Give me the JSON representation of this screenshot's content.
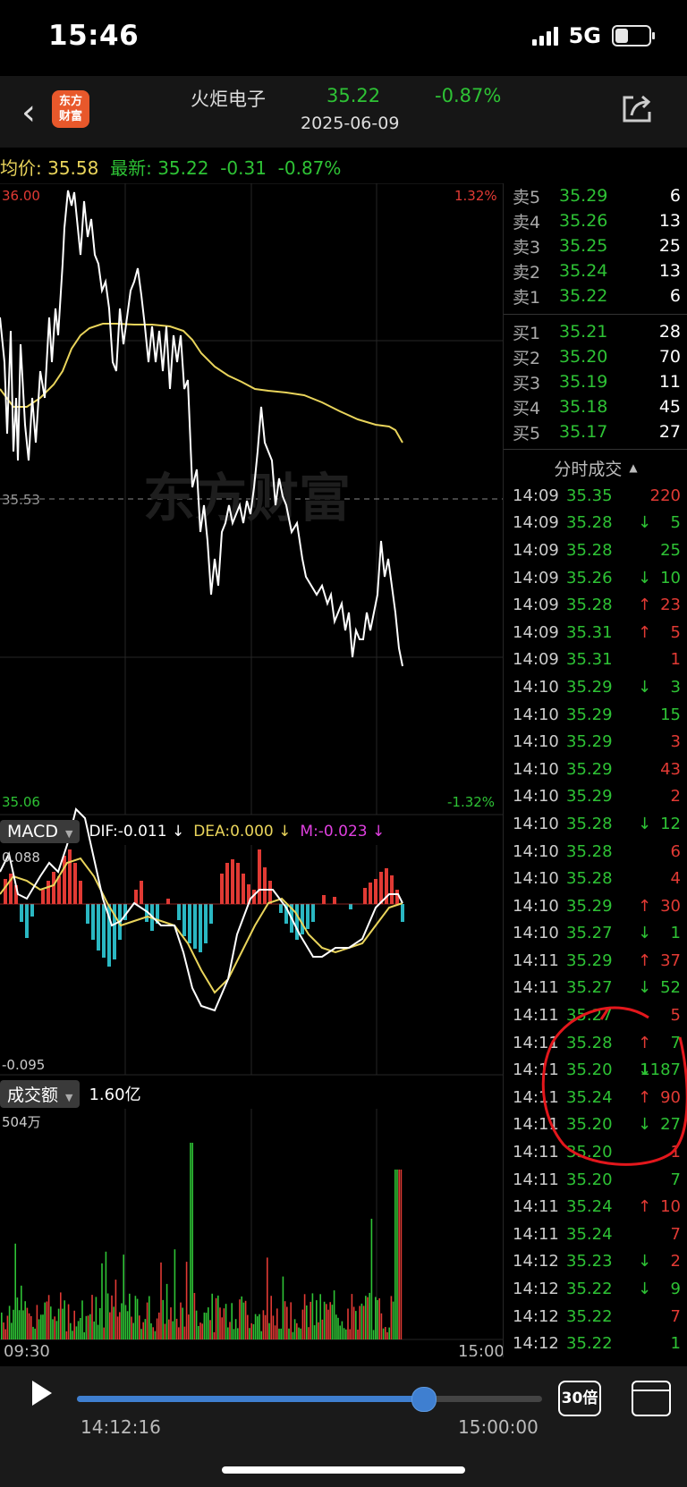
{
  "status": {
    "time": "15:46",
    "network": "5G"
  },
  "header": {
    "name": "火炬电子",
    "price": "35.22",
    "change_pct": "-0.87%",
    "date": "2025-06-09",
    "logo_text": "东方财富"
  },
  "info": {
    "avg_label": "均价:",
    "avg_value": "35.58",
    "latest_label": "最新:",
    "latest_value": "35.22",
    "change": "-0.31",
    "change_pct": "-0.87%"
  },
  "price_chart": {
    "y_high": "36.00",
    "y_mid": "35.53",
    "y_low": "35.06",
    "pct_high": "1.32%",
    "pct_low": "-1.32%",
    "watermark": "东方财富"
  },
  "macd": {
    "selector": "MACD",
    "dif": "DIF:-0.011",
    "dea": "DEA:0.000",
    "m": "M:-0.023",
    "arrow": "↓",
    "y_high": "0.088",
    "y_low": "-0.095"
  },
  "volume": {
    "selector": "成交额",
    "total": "1.60亿",
    "y_max": "504万",
    "x_start": "09:30",
    "x_end": "15:00"
  },
  "orderbook": {
    "sells": [
      {
        "label": "卖5",
        "price": "35.29",
        "vol": "6"
      },
      {
        "label": "卖4",
        "price": "35.26",
        "vol": "13"
      },
      {
        "label": "卖3",
        "price": "35.25",
        "vol": "25"
      },
      {
        "label": "卖2",
        "price": "35.24",
        "vol": "13"
      },
      {
        "label": "卖1",
        "price": "35.22",
        "vol": "6"
      }
    ],
    "buys": [
      {
        "label": "买1",
        "price": "35.21",
        "vol": "28"
      },
      {
        "label": "买2",
        "price": "35.20",
        "vol": "70"
      },
      {
        "label": "买3",
        "price": "35.19",
        "vol": "11"
      },
      {
        "label": "买4",
        "price": "35.18",
        "vol": "45"
      },
      {
        "label": "买5",
        "price": "35.17",
        "vol": "27"
      }
    ]
  },
  "ticks_header": {
    "title": "分时成交",
    "arrow": "▲"
  },
  "ticks": [
    {
      "t": "14:09",
      "p": "35.35",
      "a": "",
      "v": "220",
      "c": "red"
    },
    {
      "t": "14:09",
      "p": "35.28",
      "a": "↓",
      "v": "5",
      "c": "green"
    },
    {
      "t": "14:09",
      "p": "35.28",
      "a": "",
      "v": "25",
      "c": "green"
    },
    {
      "t": "14:09",
      "p": "35.26",
      "a": "↓",
      "v": "10",
      "c": "green"
    },
    {
      "t": "14:09",
      "p": "35.28",
      "a": "↑",
      "v": "23",
      "c": "red"
    },
    {
      "t": "14:09",
      "p": "35.31",
      "a": "↑",
      "v": "5",
      "c": "red"
    },
    {
      "t": "14:09",
      "p": "35.31",
      "a": "",
      "v": "1",
      "c": "red"
    },
    {
      "t": "14:10",
      "p": "35.29",
      "a": "↓",
      "v": "3",
      "c": "green"
    },
    {
      "t": "14:10",
      "p": "35.29",
      "a": "",
      "v": "15",
      "c": "green"
    },
    {
      "t": "14:10",
      "p": "35.29",
      "a": "",
      "v": "3",
      "c": "red"
    },
    {
      "t": "14:10",
      "p": "35.29",
      "a": "",
      "v": "43",
      "c": "red"
    },
    {
      "t": "14:10",
      "p": "35.29",
      "a": "",
      "v": "2",
      "c": "red"
    },
    {
      "t": "14:10",
      "p": "35.28",
      "a": "↓",
      "v": "12",
      "c": "green"
    },
    {
      "t": "14:10",
      "p": "35.28",
      "a": "",
      "v": "6",
      "c": "red"
    },
    {
      "t": "14:10",
      "p": "35.28",
      "a": "",
      "v": "4",
      "c": "red"
    },
    {
      "t": "14:10",
      "p": "35.29",
      "a": "↑",
      "v": "30",
      "c": "red"
    },
    {
      "t": "14:10",
      "p": "35.27",
      "a": "↓",
      "v": "1",
      "c": "green"
    },
    {
      "t": "14:11",
      "p": "35.29",
      "a": "↑",
      "v": "37",
      "c": "red"
    },
    {
      "t": "14:11",
      "p": "35.27",
      "a": "↓",
      "v": "52",
      "c": "green"
    },
    {
      "t": "14:11",
      "p": "35.27",
      "a": "",
      "v": "5",
      "c": "red"
    },
    {
      "t": "14:11",
      "p": "35.28",
      "a": "↑",
      "v": "7",
      "c": "green"
    },
    {
      "t": "14:11",
      "p": "35.20",
      "a": "↓",
      "v": "1187",
      "c": "green"
    },
    {
      "t": "14:11",
      "p": "35.24",
      "a": "↑",
      "v": "90",
      "c": "red"
    },
    {
      "t": "14:11",
      "p": "35.20",
      "a": "↓",
      "v": "27",
      "c": "green"
    },
    {
      "t": "14:11",
      "p": "35.20",
      "a": "",
      "v": "1",
      "c": "red"
    },
    {
      "t": "14:11",
      "p": "35.20",
      "a": "",
      "v": "7",
      "c": "green"
    },
    {
      "t": "14:11",
      "p": "35.24",
      "a": "↑",
      "v": "10",
      "c": "red"
    },
    {
      "t": "14:11",
      "p": "35.24",
      "a": "",
      "v": "7",
      "c": "red"
    },
    {
      "t": "14:12",
      "p": "35.23",
      "a": "↓",
      "v": "2",
      "c": "red"
    },
    {
      "t": "14:12",
      "p": "35.22",
      "a": "↓",
      "v": "9",
      "c": "green"
    },
    {
      "t": "14:12",
      "p": "35.22",
      "a": "",
      "v": "7",
      "c": "red"
    },
    {
      "t": "14:12",
      "p": "35.22",
      "a": "",
      "v": "1",
      "c": "green"
    }
  ],
  "playback": {
    "current": "14:12:16",
    "end": "15:00:00",
    "progress": 0.745,
    "speed": "30倍"
  },
  "colors": {
    "up": "#e13a34",
    "down": "#2ec235",
    "avg": "#e9d45b",
    "accent": "#3f7fd0"
  }
}
